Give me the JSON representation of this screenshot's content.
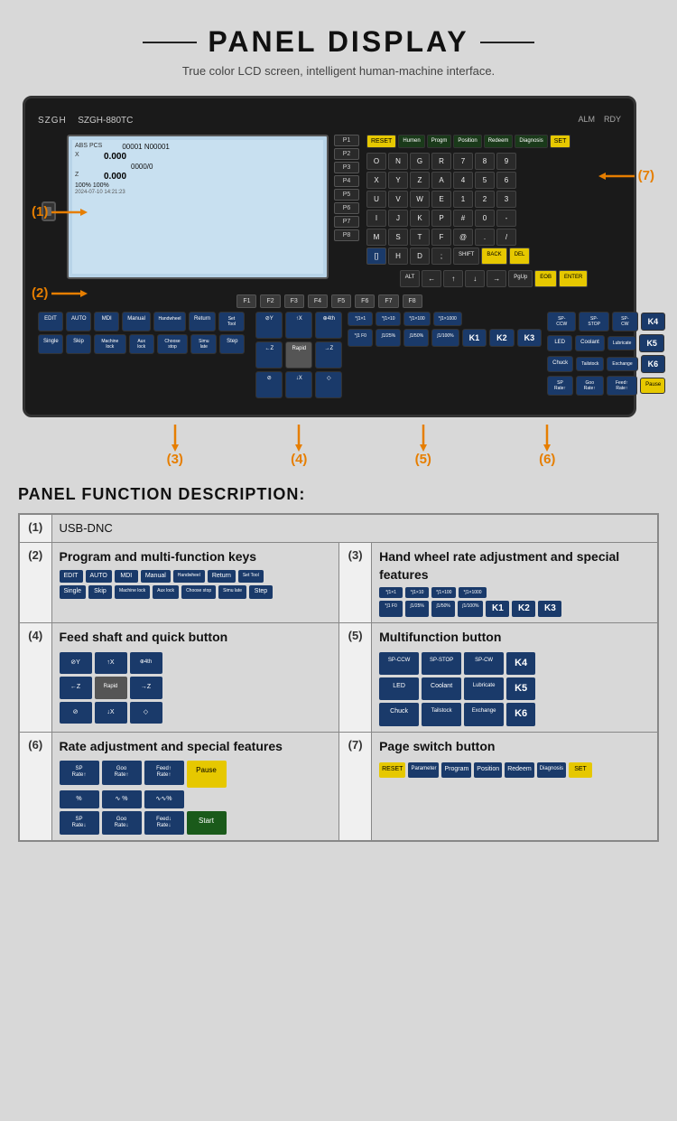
{
  "header": {
    "title": "PANEL DISPLAY",
    "subtitle": "True color LCD screen, intelligent human-machine interface.",
    "brand": "SZGH",
    "model": "SZGH-880TC"
  },
  "callouts": {
    "labels": [
      "(1)",
      "(2)",
      "(3)",
      "(4)",
      "(5)",
      "(6)",
      "(7)"
    ],
    "positions": [
      {
        "id": "1",
        "label": "(1)",
        "arrow_dir": "right"
      },
      {
        "id": "2",
        "label": "(2)",
        "arrow_dir": "right"
      },
      {
        "id": "3",
        "label": "(3)",
        "arrow_dir": "up"
      },
      {
        "id": "4",
        "label": "(4)",
        "arrow_dir": "up"
      },
      {
        "id": "5",
        "label": "(5)",
        "arrow_dir": "up"
      },
      {
        "id": "6",
        "label": "(6)",
        "arrow_dir": "up"
      },
      {
        "id": "7",
        "label": "(7)",
        "arrow_dir": "left"
      }
    ]
  },
  "description_title": "PANEL FUNCTION DESCRIPTION:",
  "rows": [
    {
      "num": "(1)",
      "left_title": "USB-DNC",
      "left_desc": "",
      "right_num": null,
      "right_title": null,
      "right_desc": null
    },
    {
      "num": "(2)",
      "left_title": "Program and multi-function keys",
      "left_btns": [
        "EDIT",
        "AUTO",
        "MDI",
        "Manual",
        "Handwheel",
        "Return",
        "Set Tool",
        "Single",
        "Skip",
        "Machine lock",
        "Aux lock",
        "Choose stop",
        "Simu late",
        "Step"
      ],
      "right_num": "(3)",
      "right_title": "Hand wheel rate adjustment and special features",
      "right_btns": [
        "*∫1×1",
        "*∫1×10",
        "*∫1×100",
        "*∫1×1000",
        "*∫1 F0",
        "∫1/25%",
        "∫1/50%",
        "∫1/100%",
        "K1",
        "K2",
        "K3"
      ]
    },
    {
      "num": "(4)",
      "left_title": "Feed shaft and quick button",
      "left_btns": [
        "⊘Y",
        "↑X",
        "⊕4th",
        "←Z",
        "Rapid",
        "→Z",
        "⊘",
        "↓X",
        "◇"
      ],
      "right_num": "(5)",
      "right_title": "Multifunction button",
      "right_btns": [
        "SP-CCW",
        "SP-STOP",
        "SP-CW",
        "K4",
        "LED",
        "Coolant",
        "Lubricate",
        "K5",
        "Chuck",
        "Tailstock",
        "Exchange",
        "K6"
      ]
    },
    {
      "num": "(6)",
      "left_title": "Rate adjustment and special features",
      "left_btns": [
        "SP Rate↑",
        "Goo Rate↑",
        "Feed↑ Rate↑",
        "Pause",
        "SP Rate↓",
        "Goo Rate↓",
        "Feed↓ Rate↓",
        "Start"
      ],
      "right_num": "(7)",
      "right_title": "Page switch button",
      "right_btns": [
        "RESET",
        "Parameter",
        "Program",
        "Position",
        "Redeem",
        "Diagnosis",
        "SET"
      ]
    }
  ]
}
